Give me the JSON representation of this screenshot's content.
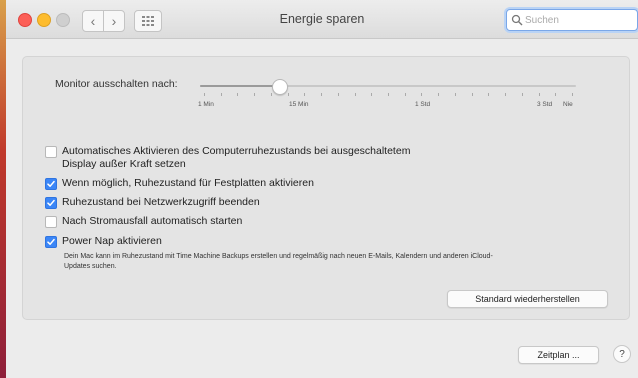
{
  "window": {
    "title": "Energie sparen"
  },
  "toolbar": {
    "search_placeholder": "Suchen"
  },
  "display_sleep": {
    "label": "Monitor ausschalten nach:",
    "tick_labels": [
      "1 Min",
      "15 Min",
      "1 Std",
      "3 Std",
      "Nie"
    ],
    "value_fraction": 0.21
  },
  "options": [
    {
      "label": "Automatisches Aktivieren des Computerruhezustands bei ausgeschaltetem",
      "label2": "Display außer Kraft setzen",
      "checked": false
    },
    {
      "label": "Wenn möglich, Ruhezustand für Festplatten aktivieren",
      "checked": true
    },
    {
      "label": "Ruhezustand bei Netzwerkzugriff beenden",
      "checked": true
    },
    {
      "label": "Nach Stromausfall automatisch starten",
      "checked": false
    },
    {
      "label": "Power Nap aktivieren",
      "checked": true
    }
  ],
  "power_nap_description": "Dein Mac kann im Ruhezustand mit Time Machine Backups erstellen und regelmäßig nach neuen E-Mails, Kalendern und anderen iCloud-Updates suchen.",
  "buttons": {
    "restore_defaults": "Standard wiederherstellen",
    "schedule": "Zeitplan ...",
    "help": "?"
  }
}
